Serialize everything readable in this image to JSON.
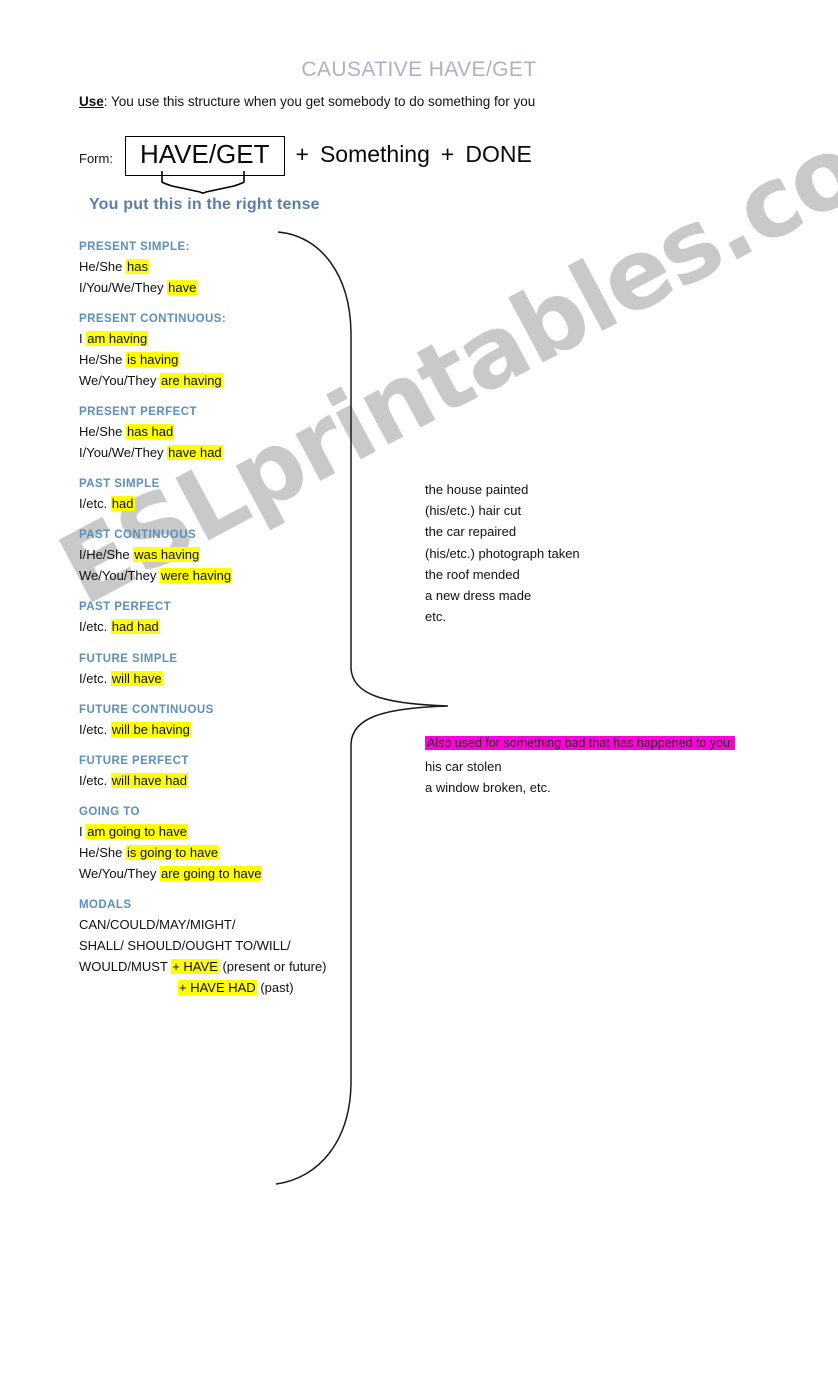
{
  "title": "CAUSATIVE HAVE/GET",
  "use": {
    "label": "Use",
    "text": ": You use this structure when you get somebody to do something for you"
  },
  "form": {
    "label": "Form:",
    "box": "HAVE/GET",
    "plus1": "+",
    "something": "Something",
    "plus2": "+",
    "done": "DONE"
  },
  "subtitle": "You put this in the right tense",
  "tenses": [
    {
      "heading": "PRESENT SIMPLE:",
      "lines": [
        {
          "plain": "He/She ",
          "hl": "has",
          "tail": ""
        },
        {
          "plain": "I/You/We/They ",
          "hl": "have",
          "tail": ""
        }
      ]
    },
    {
      "heading": " PRESENT CONTINUOUS:",
      "lines": [
        {
          "plain": "I ",
          "hl": "am having",
          "tail": ""
        },
        {
          "plain": "He/She ",
          "hl": "is having",
          "tail": ""
        },
        {
          "plain": "We/You/They ",
          "hl": "are having",
          "tail": ""
        }
      ]
    },
    {
      "heading": "PRESENT PERFECT",
      "lines": [
        {
          "plain": "He/She ",
          "hl": "has had",
          "tail": ""
        },
        {
          "plain": "I/You/We/They ",
          "hl": "have had",
          "tail": ""
        }
      ]
    },
    {
      "heading": "PAST SIMPLE",
      "lines": [
        {
          "plain": "I/etc.  ",
          "hl": "had",
          "tail": ""
        }
      ]
    },
    {
      "heading": "PAST CONTINUOUS",
      "lines": [
        {
          "plain": "I/He/She ",
          "hl": "was having",
          "tail": ""
        },
        {
          "plain": "We/You/They ",
          "hl": "were having",
          "tail": ""
        }
      ]
    },
    {
      "heading": "PAST PERFECT",
      "lines": [
        {
          "plain": "I/etc. ",
          "hl": "had had",
          "tail": ""
        }
      ]
    },
    {
      "heading": "FUTURE SIMPLE",
      "lines": [
        {
          "plain": "I/etc. ",
          "hl": "will have",
          "tail": ""
        }
      ]
    },
    {
      "heading": "FUTURE CONTINUOUS",
      "lines": [
        {
          "plain": "I/etc. ",
          "hl": "will be having",
          "tail": ""
        }
      ]
    },
    {
      "heading": "FUTURE PERFECT",
      "lines": [
        {
          "plain": "I/etc. ",
          "hl": "will have had",
          "tail": ""
        }
      ]
    },
    {
      "heading": "GOING TO",
      "lines": [
        {
          "plain": "I ",
          "hl": "am going to have",
          "tail": ""
        },
        {
          "plain": "He/She ",
          "hl": "is going to have",
          "tail": ""
        },
        {
          "plain": "We/You/They ",
          "hl": "are going to have",
          "tail": ""
        }
      ]
    },
    {
      "heading": "MODALS",
      "lines": [
        {
          "plain": "CAN/COULD/MAY/MIGHT/",
          "hl": "",
          "tail": ""
        },
        {
          "plain": "SHALL/ SHOULD/OUGHT TO/WILL/",
          "hl": "",
          "tail": ""
        },
        {
          "plain": "WOULD/MUST ",
          "hl": "+ HAVE",
          "tail": "  (present or future)"
        },
        {
          "plain": "",
          "hl": "+ HAVE HAD",
          "tail": " (past)",
          "indent": true
        }
      ]
    }
  ],
  "objects": [
    "the house painted",
    "(his/etc.) hair cut",
    " the car repaired",
    "(his/etc.) photograph taken",
    "the roof mended",
    " a new dress made",
    "etc."
  ],
  "bad_note": {
    "heading": "Also used for something bad that has happened to  you:",
    "lines": [
      "his car stolen",
      "a window broken, etc."
    ]
  },
  "watermark": "ESLprintables.com",
  "colors": {
    "title": "#b3aec6",
    "heading_blue": "#5a8fbe",
    "subtitle_blue": "#5b7ea8",
    "highlight_yellow": "#ffff00",
    "highlight_pink": "#ff00dd",
    "text": "#101010",
    "watermark": "#c9c9c9"
  }
}
